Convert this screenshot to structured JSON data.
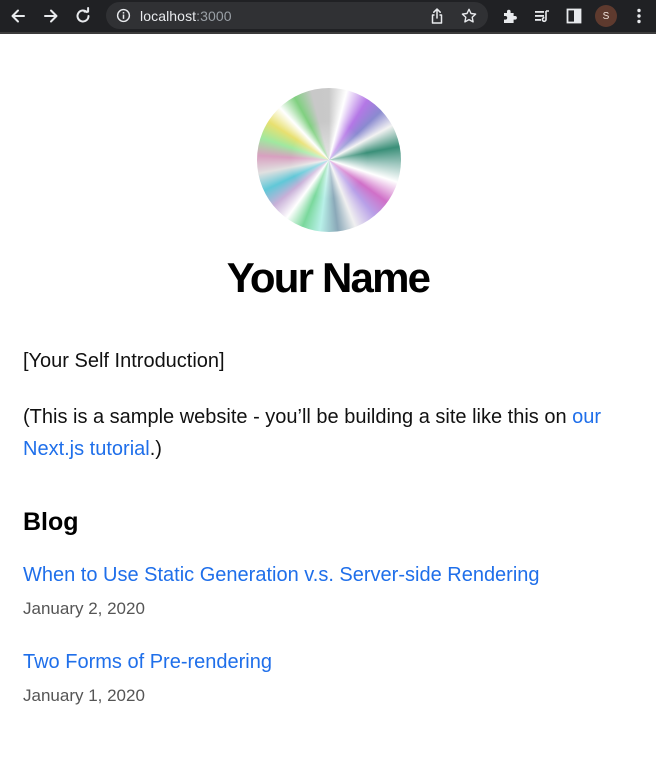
{
  "browser": {
    "url_host": "localhost",
    "url_port": ":3000",
    "profile_initial": "S",
    "icons": [
      "back-icon",
      "forward-icon",
      "reload-icon",
      "info-icon",
      "share-icon",
      "star-icon",
      "extensions-icon",
      "reading-list-icon",
      "side-panel-icon",
      "menu-icon"
    ]
  },
  "page": {
    "name": "Your Name",
    "intro": "[Your Self Introduction]",
    "sample_text": "(This is a sample website - you’ll be building a site like this on ",
    "sample_link": "our Next.js tutorial",
    "sample_end": ".)",
    "blog_heading": "Blog",
    "posts": [
      {
        "title": "When to Use Static Generation v.s. Server-side Rendering",
        "date": "January 2, 2020"
      },
      {
        "title": "Two Forms of Pre-rendering",
        "date": "January 1, 2020"
      }
    ]
  },
  "colors": {
    "link": "#1f6fea",
    "chrome_bg": "#202124",
    "omnibox_bg": "#303134"
  }
}
